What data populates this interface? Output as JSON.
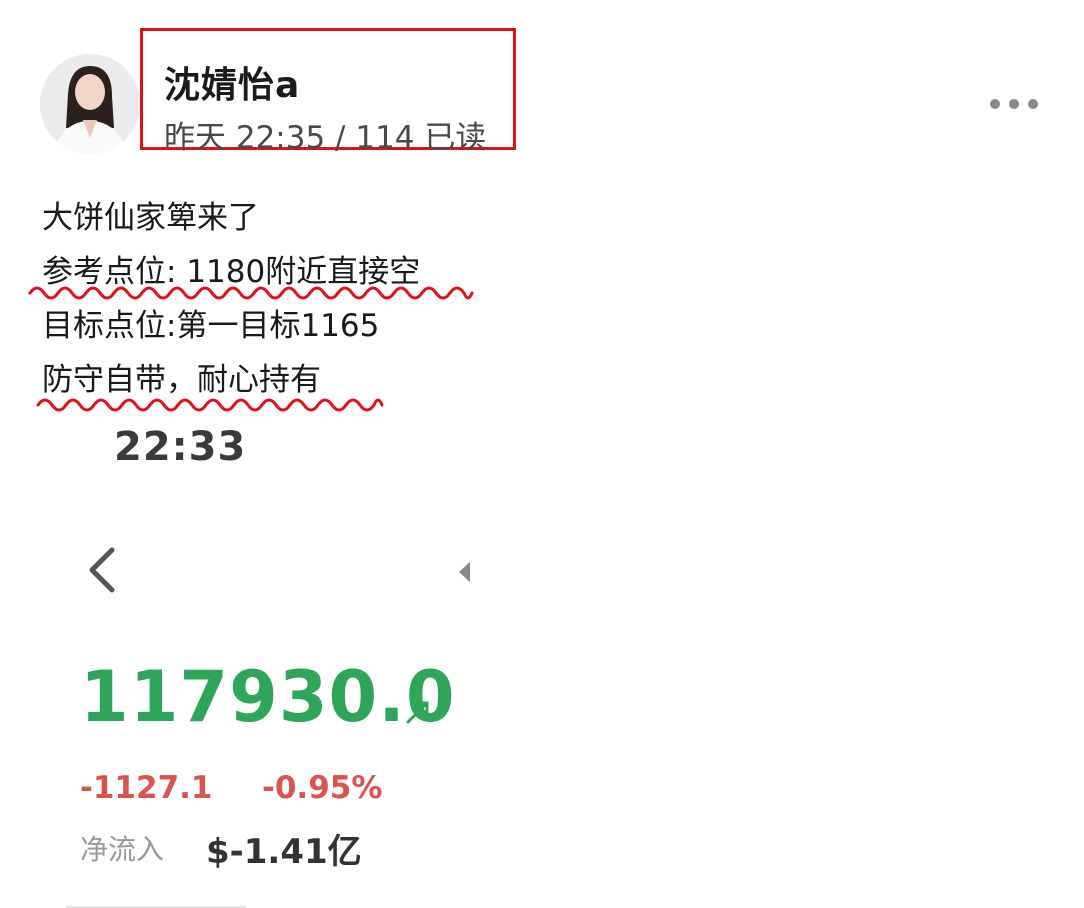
{
  "post": {
    "author": "沈婧怡a",
    "time": "昨天 22:35 / 114 已读",
    "lines": [
      "大饼仙家箄来了",
      "参考点位: 1180附近直接空",
      "目标点位:第一目标1165",
      "防守自带，耐心持有"
    ]
  },
  "screenshot": {
    "time": "22:33",
    "price": "117930.0",
    "change": "-1127.1",
    "change_pct": "-0.95%",
    "net_inflow_label": "净流入",
    "net_inflow_value": "$-1.41亿"
  },
  "colors": {
    "highlight_box": "#e0101b",
    "wavy_underline": "#e0101b",
    "price_green": "#2ea55a",
    "change_red": "#d9534f"
  },
  "icons": {
    "more": "more-dots-icon",
    "back": "chevron-left-icon",
    "price_trend": "arrow-up-right-icon",
    "small_left": "small-triangle-left-icon"
  }
}
